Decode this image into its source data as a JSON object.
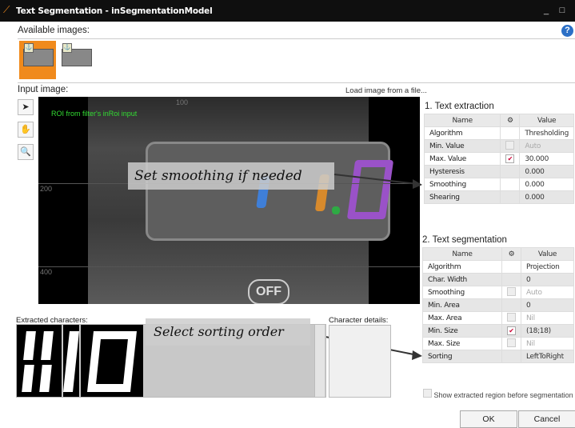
{
  "window": {
    "title": "Text Segmentation - inSegmentationModel",
    "minimize": "_",
    "maximize": "□"
  },
  "available": {
    "label": "Available images:",
    "help": "?"
  },
  "input": {
    "label": "Input image:",
    "load_link": "Load image from a file...",
    "roi_label": "ROI from filter's inRoi input"
  },
  "canvas": {
    "axis_200": "200",
    "axis_400": "400",
    "axis_top": "100",
    "button_text": "OFF",
    "digits": "1.0"
  },
  "annotations": {
    "smoothing": "Set smoothing if needed",
    "sorting": "Select sorting order"
  },
  "text_extraction": {
    "title": "1. Text extraction",
    "headers": {
      "name": "Name",
      "value": "Value"
    },
    "rows": [
      {
        "name": "Algorithm",
        "value": "Thresholding",
        "cb": "none",
        "dim": false
      },
      {
        "name": "Min. Value",
        "value": "Auto",
        "cb": "off",
        "dim": true
      },
      {
        "name": "Max. Value",
        "value": "30.000",
        "cb": "on",
        "dim": false
      },
      {
        "name": "Hysteresis",
        "value": "0.000",
        "cb": "none",
        "dim": false
      },
      {
        "name": "Smoothing",
        "value": "0.000",
        "cb": "none",
        "dim": false
      },
      {
        "name": "Shearing",
        "value": "0.000",
        "cb": "none",
        "dim": false
      }
    ]
  },
  "text_segmentation": {
    "title": "2. Text segmentation",
    "headers": {
      "name": "Name",
      "value": "Value"
    },
    "rows": [
      {
        "name": "Algorithm",
        "value": "Projection",
        "cb": "none",
        "dim": false
      },
      {
        "name": "Char. Width",
        "value": "0",
        "cb": "none",
        "dim": false
      },
      {
        "name": "Smoothing",
        "value": "Auto",
        "cb": "off",
        "dim": true
      },
      {
        "name": "Min. Area",
        "value": "0",
        "cb": "none",
        "dim": false
      },
      {
        "name": "Max. Area",
        "value": "Nil",
        "cb": "off",
        "dim": true
      },
      {
        "name": "Min. Size",
        "value": "(18;18)",
        "cb": "on",
        "dim": false
      },
      {
        "name": "Max. Size",
        "value": "Nil",
        "cb": "off",
        "dim": true
      },
      {
        "name": "Sorting",
        "value": "LeftToRight",
        "cb": "none",
        "dim": false
      }
    ]
  },
  "extracted": {
    "label": "Extracted characters:"
  },
  "details": {
    "label": "Character details:"
  },
  "options": {
    "show_region": "Show extracted region before segmentation"
  },
  "buttons": {
    "ok": "OK",
    "cancel": "Cancel"
  },
  "colors": {
    "accent": "#f08a1c",
    "seg_blue": "#3f7fd8",
    "seg_orange": "#d88a2c",
    "seg_purple": "#9a52c8",
    "roi_green": "#33dd33"
  },
  "icons": [
    "pointer-icon",
    "hand-icon",
    "zoom-icon",
    "help-icon"
  ]
}
